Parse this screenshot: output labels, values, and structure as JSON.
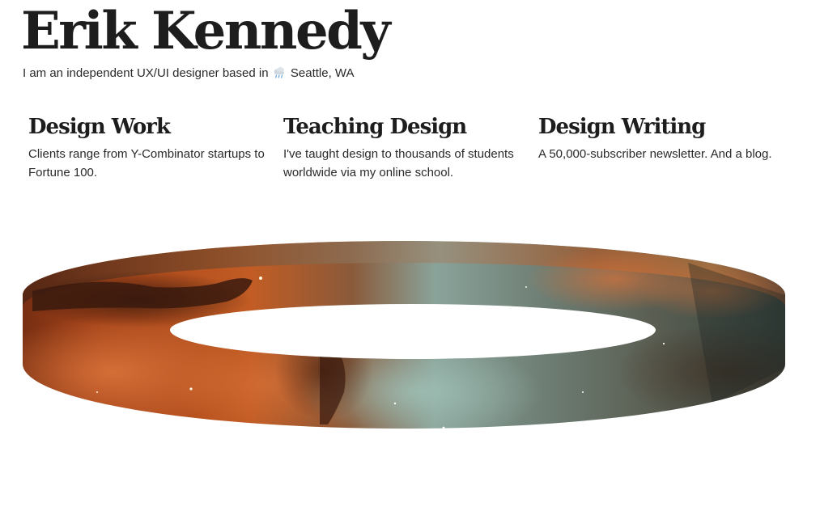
{
  "header": {
    "name": "Erik Kennedy",
    "tagline_before": "I am an independent UX/UI designer based in",
    "location_icon": "cloud-rain-icon",
    "location": "Seattle, WA"
  },
  "sections": [
    {
      "title": "Design Work",
      "description": "Clients range from Y-Combinator startups to Fortune 100."
    },
    {
      "title": "Teaching Design",
      "description": "I've taught design to thousands of students worldwide via my online school."
    },
    {
      "title": "Design Writing",
      "description": "A 50,000-subscriber newsletter. And a blog."
    }
  ],
  "hero": {
    "image": "nebula-ring-band"
  },
  "colors": {
    "text": "#1d1d1d",
    "background": "#ffffff",
    "nebula_red": "#8a3314",
    "nebula_orange": "#c05a22",
    "nebula_teal": "#7e9e95"
  }
}
